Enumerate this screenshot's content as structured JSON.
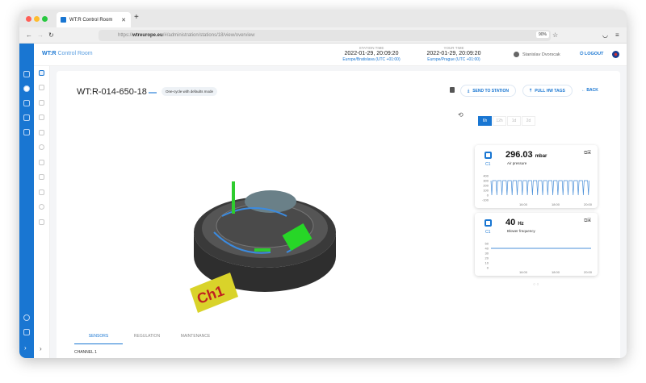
{
  "browser": {
    "tab_title": "WT:R Control Room",
    "url_prefix": "https://",
    "url_domain": "wtreurope.eu",
    "url_path": "/#/administration/stations/18/view/overview",
    "zoom": "90%"
  },
  "header": {
    "brand_bold": "WT:R",
    "brand_rest": "Control Room",
    "station_time": {
      "label": "STATION TIME",
      "value": "2022-01-29, 20:09:20",
      "zone": "Europe/Bratislava (UTC +01:00)"
    },
    "your_time": {
      "label": "YOUR TIME",
      "value": "2022-01-29, 20:09:20",
      "zone": "Europe/Prague (UTC +01:00)"
    },
    "user": "Stanislav Dvorscak",
    "logout": "LOGOUT"
  },
  "station": {
    "id": "WT:R-014-650-18",
    "mode": "One-cycle with defaults mode",
    "send": "SEND TO STATION",
    "pull": "PULL HW TAGS",
    "back": "BACK",
    "model_label": "Ch1"
  },
  "ranges": [
    "6h",
    "12h",
    "1d",
    "2d"
  ],
  "sensors": [
    {
      "channel": "C1",
      "value": "296.03",
      "unit": "mbar",
      "label": "Air pressure",
      "yticks": [
        "400",
        "300",
        "200",
        "100",
        "0",
        "-100"
      ],
      "xticks": [
        "16:00",
        "18:00",
        "20:00"
      ]
    },
    {
      "channel": "C1",
      "value": "40",
      "unit": "Hz",
      "label": "Blower frequency",
      "yticks": [
        "50",
        "40",
        "30",
        "20",
        "10",
        "0"
      ],
      "xticks": [
        "16:00",
        "18:00",
        "20:00"
      ]
    }
  ],
  "tabs": [
    "SENSORS",
    "REGULATION",
    "MAINTENANCE"
  ],
  "channel": "CHANNEL 1",
  "colors": {
    "primary": "#1976d2"
  }
}
